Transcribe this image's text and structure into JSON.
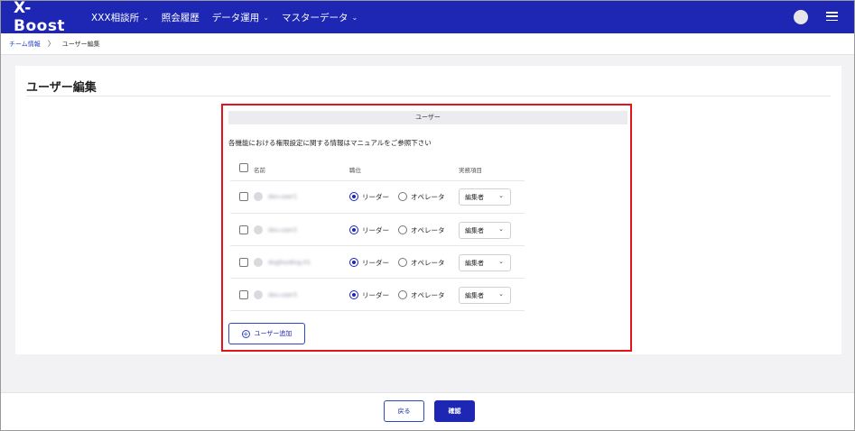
{
  "nav": {
    "logo": "X-Boost",
    "items": [
      {
        "label": "XXX相談所",
        "has_dropdown": true
      },
      {
        "label": "照会履歴",
        "has_dropdown": false
      },
      {
        "label": "データ運用",
        "has_dropdown": true
      },
      {
        "label": "マスターデータ",
        "has_dropdown": true
      }
    ]
  },
  "breadcrumb": {
    "parent": "チーム情報",
    "separator": "〉",
    "current": "ユーザー編集"
  },
  "page": {
    "title": "ユーザー編集"
  },
  "users_section": {
    "header": "ユーザー",
    "notice": "各機能における権限設定に関する情報はマニュアルをご参照下さい",
    "columns": {
      "name": "名前",
      "role": "職位",
      "task": "実務項目"
    },
    "rows": [
      {
        "name": "dev.user1",
        "role": "leader",
        "task": "編集者"
      },
      {
        "name": "dev.user2",
        "role": "leader",
        "task": "編集者"
      },
      {
        "name": "dogfooding.01",
        "role": "leader",
        "task": "編集者"
      },
      {
        "name": "dev.user3",
        "role": "leader",
        "task": "編集者"
      }
    ],
    "role_labels": {
      "leader": "リーダー",
      "operator": "オペレータ"
    },
    "add_button": "ユーザー追加"
  },
  "footer": {
    "back": "戻る",
    "confirm": "確認"
  },
  "colors": {
    "brand": "#1d27b3",
    "highlight": "#e3121b"
  }
}
